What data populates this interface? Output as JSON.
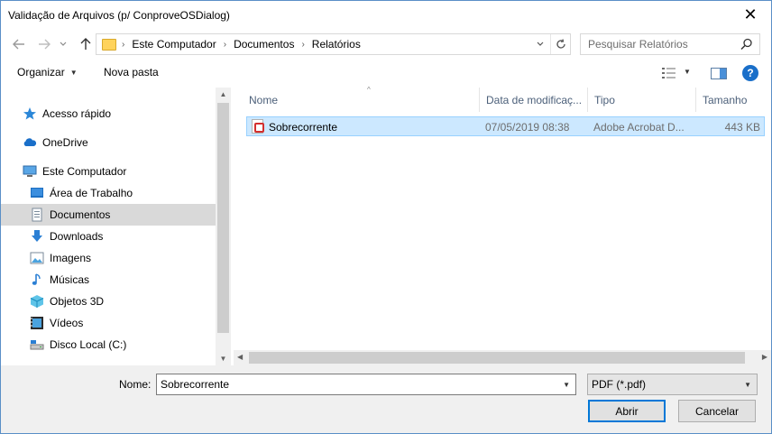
{
  "window": {
    "title": "Validação de Arquivos (p/ ConproveOSDialog)",
    "close_glyph": "✕"
  },
  "address": {
    "crumbs": [
      "Este Computador",
      "Documentos",
      "Relatórios"
    ],
    "search_placeholder": "Pesquisar Relatórios"
  },
  "toolbar": {
    "organize_label": "Organizar",
    "new_folder_label": "Nova pasta",
    "help_glyph": "?"
  },
  "nav": {
    "items": [
      {
        "label": "Acesso rápido",
        "icon": "star-icon"
      },
      {
        "label": "OneDrive",
        "icon": "cloud-icon"
      },
      {
        "label": "Este Computador",
        "icon": "computer-icon"
      },
      {
        "label": "Área de Trabalho",
        "icon": "desktop-icon"
      },
      {
        "label": "Documentos",
        "icon": "document-icon",
        "selected": true
      },
      {
        "label": "Downloads",
        "icon": "download-icon"
      },
      {
        "label": "Imagens",
        "icon": "image-icon"
      },
      {
        "label": "Músicas",
        "icon": "music-icon"
      },
      {
        "label": "Objetos 3D",
        "icon": "cube-icon"
      },
      {
        "label": "Vídeos",
        "icon": "video-icon"
      },
      {
        "label": "Disco Local (C:)",
        "icon": "drive-icon"
      }
    ]
  },
  "files": {
    "columns": [
      "Nome",
      "Data de modificaç...",
      "Tipo",
      "Tamanho"
    ],
    "rows": [
      {
        "name": "Sobrecorrente",
        "modified": "07/05/2019 08:38",
        "type": "Adobe Acrobat D...",
        "size": "443 KB",
        "icon": "pdf-icon"
      }
    ]
  },
  "footer": {
    "name_label": "Nome:",
    "name_value": "Sobrecorrente",
    "file_type": "PDF (*.pdf)",
    "open_label": "Abrir",
    "cancel_label": "Cancelar"
  },
  "colors": {
    "selection_bg": "#cce8ff",
    "selection_border": "#99d1ff",
    "accent": "#0078d7"
  }
}
